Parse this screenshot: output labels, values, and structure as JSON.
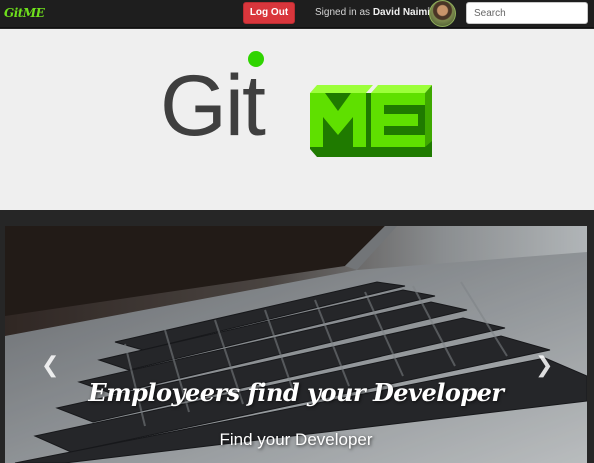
{
  "navbar": {
    "brand": "GitME",
    "logout_label": "Log Out",
    "signed_in_prefix": "Signed in as",
    "user_name": "David Naimi",
    "search_placeholder": "Search"
  },
  "logo": {
    "text_git": "Git",
    "text_me": "ME",
    "colors": {
      "git": "#3f3f3f",
      "dot": "#2fd400",
      "me": "#59e000"
    }
  },
  "carousel": {
    "headline": "Employeers find your Developer",
    "subline": "Find your Developer",
    "prev_icon": "chevron-left",
    "next_icon": "chevron-right"
  },
  "colors": {
    "accent": "#d9363c",
    "brand_green": "#6fe01c",
    "nav_bg": "#1e1e1e"
  }
}
